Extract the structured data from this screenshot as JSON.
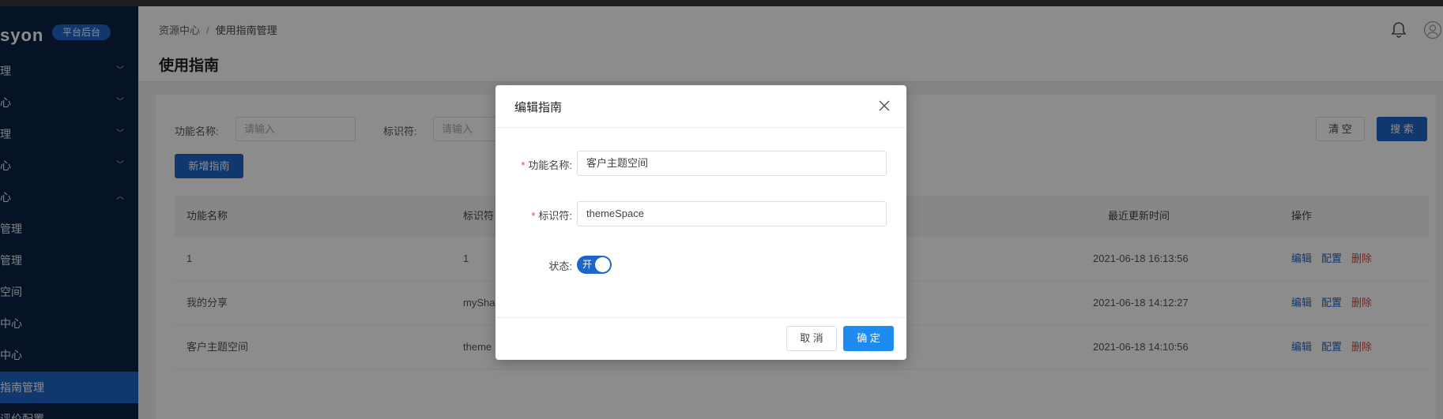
{
  "logo": {
    "text": "syon",
    "badge": "平台后台"
  },
  "sidebar": {
    "items": [
      {
        "label": "理",
        "chevron": "chevron-down"
      },
      {
        "label": "心",
        "chevron": "chevron-down"
      },
      {
        "label": "理",
        "chevron": "chevron-down"
      },
      {
        "label": "心",
        "chevron": "chevron-down"
      },
      {
        "label": "心",
        "chevron": "chevron-up"
      },
      {
        "label": "管理"
      },
      {
        "label": "管理"
      },
      {
        "label": "空间"
      },
      {
        "label": "中心"
      },
      {
        "label": "中心"
      },
      {
        "label": "指南管理",
        "active": true
      },
      {
        "label": "评价配置"
      }
    ]
  },
  "header": {
    "breadcrumb": [
      "资源中心",
      "使用指南管理"
    ],
    "breadcrumb_sep": "/",
    "title": "使用指南"
  },
  "search": {
    "name_label": "功能名称:",
    "name_placeholder": "请输入",
    "id_label": "标识符:",
    "id_placeholder": "请输入",
    "clear_label": "清 空",
    "search_label": "搜 索",
    "add_label": "新增指南"
  },
  "table": {
    "columns": [
      "功能名称",
      "标识符",
      "最近更新时间",
      "操作"
    ],
    "rows": [
      {
        "name": "1",
        "identifier": "1",
        "updated": "2021-06-18 16:13:56"
      },
      {
        "name": "我的分享",
        "identifier": "mySha",
        "updated": "2021-06-18 14:12:27"
      },
      {
        "name": "客户主题空间",
        "identifier": "theme",
        "updated": "2021-06-18 14:10:56"
      }
    ],
    "actions": {
      "edit": "编辑",
      "config": "配置",
      "delete": "删除"
    }
  },
  "modal": {
    "title": "编辑指南",
    "name_label": "功能名称:",
    "name_value": "客户主题空间",
    "id_label": "标识符:",
    "id_value": "themeSpace",
    "status_label": "状态:",
    "status_on_text": "开",
    "required_mark": "*",
    "cancel_label": "取 消",
    "ok_label": "确 定"
  },
  "colors": {
    "primary": "#1e66c9",
    "sidebar": "#0b2146",
    "danger": "#e0413c"
  }
}
